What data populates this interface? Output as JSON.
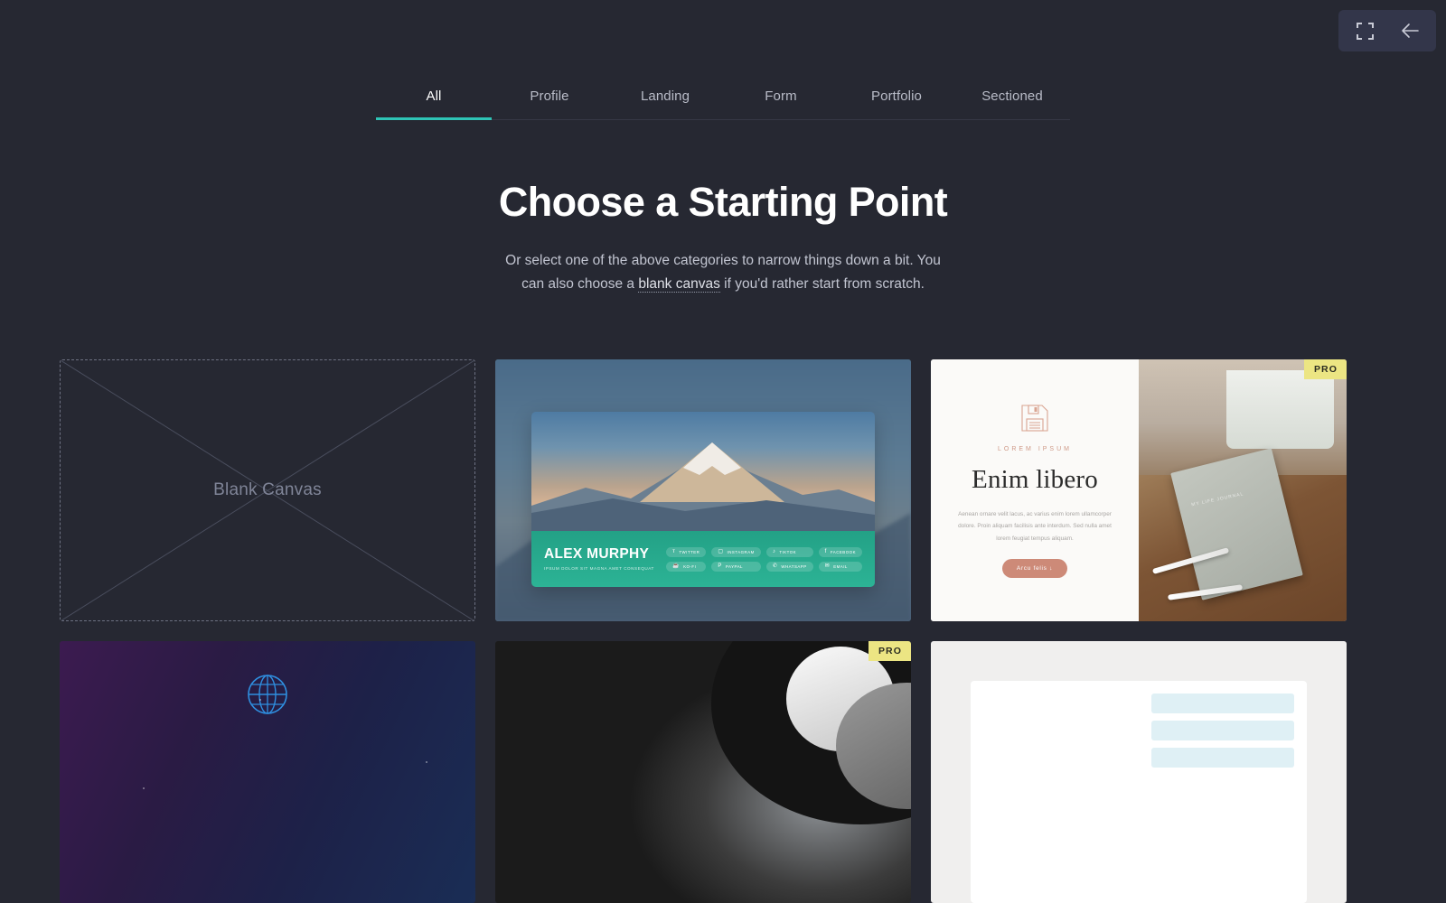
{
  "toolbar": {
    "marquee_icon": "marquee-select-icon",
    "back_icon": "arrow-left-icon"
  },
  "tabs": [
    {
      "label": "All",
      "active": true
    },
    {
      "label": "Profile",
      "active": false
    },
    {
      "label": "Landing",
      "active": false
    },
    {
      "label": "Form",
      "active": false
    },
    {
      "label": "Portfolio",
      "active": false
    },
    {
      "label": "Sectioned",
      "active": false
    }
  ],
  "hero": {
    "title": "Choose a Starting Point",
    "subtitle_part1": "Or select one of the above categories to narrow things down a bit. You can also choose a ",
    "subtitle_link": "blank canvas",
    "subtitle_part2": " if you'd rather start from scratch."
  },
  "cards": {
    "blank": {
      "label": "Blank Canvas"
    },
    "mountain": {
      "name": "ALEX MURPHY",
      "tagline": "IPSUM DOLOR SIT MAGNA AMET CONSEQUAT",
      "socials": [
        {
          "label": "TWITTER",
          "glyph": "ᴛ",
          "icon": "twitter-icon"
        },
        {
          "label": "INSTAGRAM",
          "glyph": "▢",
          "icon": "instagram-icon"
        },
        {
          "label": "TIKTOK",
          "glyph": "♪",
          "icon": "tiktok-icon"
        },
        {
          "label": "FACEBOOK",
          "glyph": "f",
          "icon": "facebook-icon"
        },
        {
          "label": "KO-FI",
          "glyph": "☕",
          "icon": "kofi-icon"
        },
        {
          "label": "PAYPAL",
          "glyph": "P",
          "icon": "paypal-icon"
        },
        {
          "label": "WHATSAPP",
          "glyph": "✆",
          "icon": "whatsapp-icon"
        },
        {
          "label": "EMAIL",
          "glyph": "✉",
          "icon": "email-icon"
        }
      ]
    },
    "enim": {
      "badge": "PRO",
      "eyebrow": "LOREM IPSUM",
      "title": "Enim libero",
      "body": "Aenean ornare velit lacus, ac varius enim lorem ullamcorper dolore. Proin aliquam facilisis ante interdum. Sed nulla amet lorem feugiat tempus aliquam.",
      "button": "Arcu felis ↓",
      "icon": "floppy-disk-icon",
      "journal_text": "MY LIFE JOURNAL"
    },
    "globe": {
      "icon": "globe-icon"
    },
    "photo": {
      "badge": "PRO"
    },
    "light": {}
  },
  "colors": {
    "page_bg": "#262832",
    "accent": "#2ec4b6",
    "pro_badge_bg": "#ece583",
    "toolbar_bg": "#33364a",
    "mtn_footer": "#2cb395",
    "enim_accent": "#cd8a78"
  }
}
